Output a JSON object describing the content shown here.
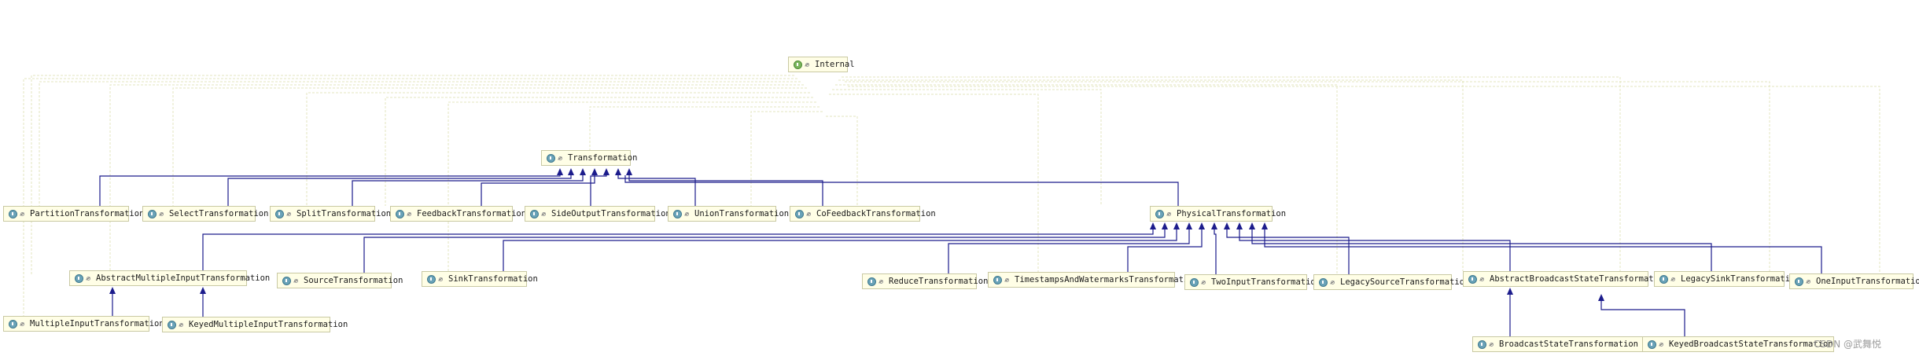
{
  "diagram": {
    "interface_node": "Internal",
    "nodes": {
      "transformation": "Transformation",
      "partition": "PartitionTransformation",
      "select": "SelectTransformation",
      "split": "SplitTransformation",
      "feedback": "FeedbackTransformation",
      "side_output": "SideOutputTransformation",
      "union": "UnionTransformation",
      "co_feedback": "CoFeedbackTransformation",
      "physical": "PhysicalTransformation",
      "abstract_multi": "AbstractMultipleInputTransformation",
      "source": "SourceTransformation",
      "sink": "SinkTransformation",
      "reduce": "ReduceTransformation",
      "timestamps": "TimestampsAndWatermarksTransformation",
      "two_input": "TwoInputTransformation",
      "legacy_source": "LegacySourceTransformation",
      "abstract_broadcast": "AbstractBroadcastStateTransformation",
      "legacy_sink": "LegacySinkTransformation",
      "one_input": "OneInputTransformation",
      "multiple_input": "MultipleInputTransformation",
      "keyed_multiple_input": "KeyedMultipleInputTransformation",
      "broadcast_state": "BroadcastStateTransformation",
      "keyed_broadcast_state": "KeyedBroadcastStateTransformation"
    }
  },
  "watermark": "CSDN @武舞悦",
  "colors": {
    "inheritance_line": "#1c1c8c",
    "dependency_line": "#e3e6bf",
    "node_background": "#fffee6",
    "node_border": "#c9c9a3"
  }
}
